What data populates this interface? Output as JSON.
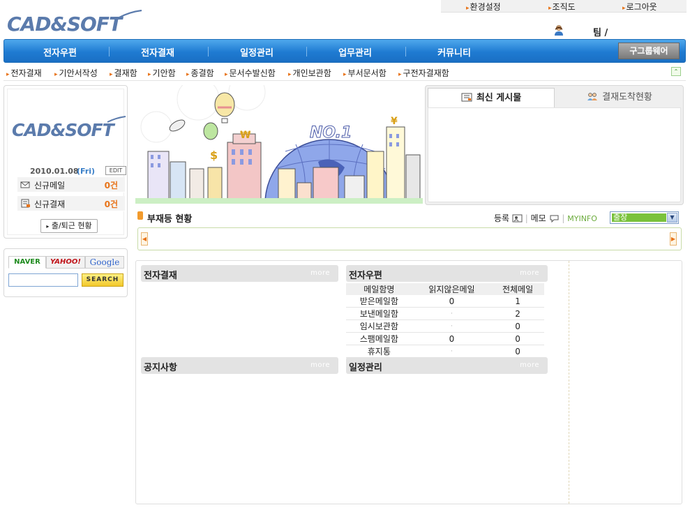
{
  "utility": {
    "settings": "환경설정",
    "org_chart": "조직도",
    "logout": "로그아웃"
  },
  "logo": {
    "text": "CAD&SOFT"
  },
  "user": {
    "team": "팀 /"
  },
  "main_nav": [
    {
      "label": "전자우편"
    },
    {
      "label": "전자결재"
    },
    {
      "label": "일정관리"
    },
    {
      "label": "업무관리"
    },
    {
      "label": "커뮤니티"
    }
  ],
  "groupware_button": "구그룹웨어",
  "sub_nav": [
    {
      "label": "전자결재"
    },
    {
      "label": "기안서작성"
    },
    {
      "label": "결재함"
    },
    {
      "label": "기안함"
    },
    {
      "label": "종결함"
    },
    {
      "label": "문서수발신함"
    },
    {
      "label": "개인보관함"
    },
    {
      "label": "부서문서함"
    },
    {
      "label": "구전자결재함"
    }
  ],
  "left_panel": {
    "logo_text": "CAD&SOFT",
    "date": "2010.01.08",
    "day": "(Fri)",
    "edit_label": "EDIT",
    "new_mail": {
      "label": "신규메일",
      "count": "0건"
    },
    "new_approval": {
      "label": "신규결재",
      "count": "0건"
    },
    "attendance_button": "출/퇴근 현황"
  },
  "search": {
    "tabs": [
      "NAVER",
      "YAHOO!",
      "Google"
    ],
    "input_value": "",
    "button": "SEARCH"
  },
  "banner": {
    "badge": "NO.1"
  },
  "tabs": {
    "latest_posts": "최신 게시물",
    "approval_arrival": "결재도착현황"
  },
  "absence": {
    "title": "부재등 현황",
    "register": "등록",
    "memo": "메모",
    "myinfo": "MYINFO",
    "status_selected": "출장"
  },
  "sections": {
    "approval": {
      "title": "전자결재",
      "more": "more"
    },
    "mail": {
      "title": "전자우편",
      "more": "more"
    },
    "notice": {
      "title": "공지사항",
      "more": "more"
    },
    "schedule": {
      "title": "일정관리",
      "more": "more"
    }
  },
  "mail_table": {
    "headers": [
      "메일함명",
      "읽지않은메일",
      "전체메일"
    ],
    "rows": [
      [
        "받은메일함",
        "0",
        "1"
      ],
      [
        "보낸메일함",
        "·",
        "2"
      ],
      [
        "임시보관함",
        "·",
        "0"
      ],
      [
        "스팸메일함",
        "0",
        "0"
      ],
      [
        "휴지통",
        "·",
        "0"
      ]
    ]
  },
  "colors": {
    "nav_blue": "#1f7bd2",
    "accent_orange": "#e8741a",
    "logo_blue": "#5b7bac",
    "myinfo_green": "#6bab3c",
    "select_green": "#7ac23b"
  }
}
